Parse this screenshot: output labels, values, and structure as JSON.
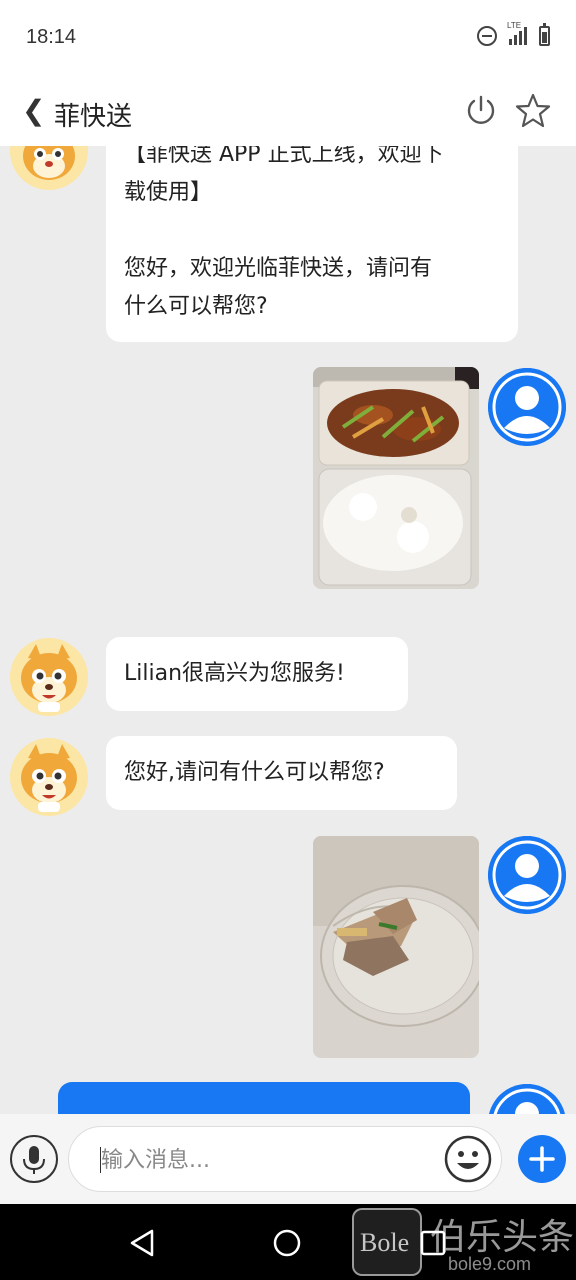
{
  "status_bar": {
    "time": "18:14",
    "network": "LTE",
    "icons": [
      "do-not-disturb-icon",
      "signal-icon",
      "battery-icon"
    ]
  },
  "header": {
    "back_icon": "chevron-left-icon",
    "title": "菲快送",
    "actions": [
      "power-icon",
      "star-icon"
    ]
  },
  "messages": [
    {
      "from": "bot",
      "line1": "【菲快送 APP 正式上线，欢迎下",
      "line2": "载使用】",
      "line3": "您好，欢迎光临菲快送，请问有",
      "line4": "什么可以帮您?"
    },
    {
      "from": "user",
      "type": "image",
      "image": "food-photo-stir-fry-and-rice"
    },
    {
      "from": "bot",
      "text": "Lilian很高兴为您服务!"
    },
    {
      "from": "bot",
      "text": "您好,请问有什么可以帮您?"
    },
    {
      "from": "user",
      "type": "image",
      "image": "food-photo-meat-in-plastic-container"
    },
    {
      "from": "user",
      "type": "text",
      "text": ""
    }
  ],
  "input_bar": {
    "placeholder": "输入消息...",
    "icons": [
      "microphone-icon",
      "emoji-icon",
      "plus-icon"
    ]
  },
  "navbar": {
    "icons": [
      "back-triangle-icon",
      "home-circle-icon",
      "recents-square-icon"
    ]
  },
  "watermark": {
    "logo_text": "Bole",
    "brand": "伯乐头条",
    "url": "bole9.com"
  },
  "colors": {
    "accent": "#1877f2",
    "chat_bg": "#ececec",
    "bubble_bg": "#ffffff"
  }
}
